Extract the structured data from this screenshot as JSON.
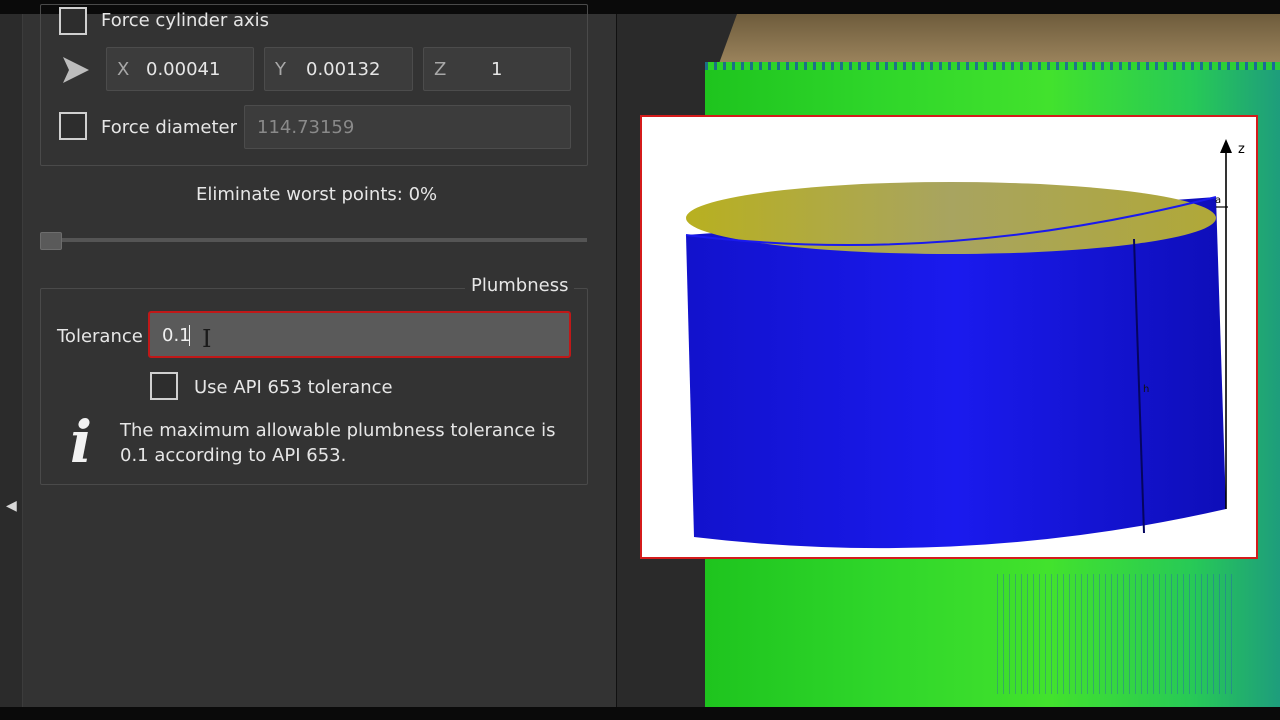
{
  "panel": {
    "force_cylinder_axis_label": "Force cylinder axis",
    "axis_fields": [
      {
        "axis": "X",
        "value": "0.00041"
      },
      {
        "axis": "Y",
        "value": "0.00132"
      },
      {
        "axis": "Z",
        "value": "1"
      }
    ],
    "force_diameter_label": "Force diameter",
    "force_diameter_value": "114.73159",
    "eliminate_worst_points_label": "Eliminate worst points:  0%",
    "eliminate_worst_points_value": 0
  },
  "plumbness": {
    "title": "Plumbness",
    "tolerance_label": "Tolerance",
    "tolerance_value": "0.1",
    "use_api_label": "Use API 653 tolerance",
    "use_api_checked": false,
    "info_text": "The maximum allowable plumbness tolerance is 0.1 according to API 653."
  },
  "diagram": {
    "axis_label": "z",
    "label_a": "a",
    "label_h": "h"
  },
  "colors": {
    "panel_bg": "#333333",
    "input_error_border": "#c01818",
    "inset_border": "#d41b1b",
    "cylinder_side": "#1010d8",
    "cylinder_top": "#a4a040"
  },
  "icons": {
    "axis_direction": "play-triangle-icon",
    "info": "info-icon",
    "collapse": "chevron-left-icon"
  }
}
